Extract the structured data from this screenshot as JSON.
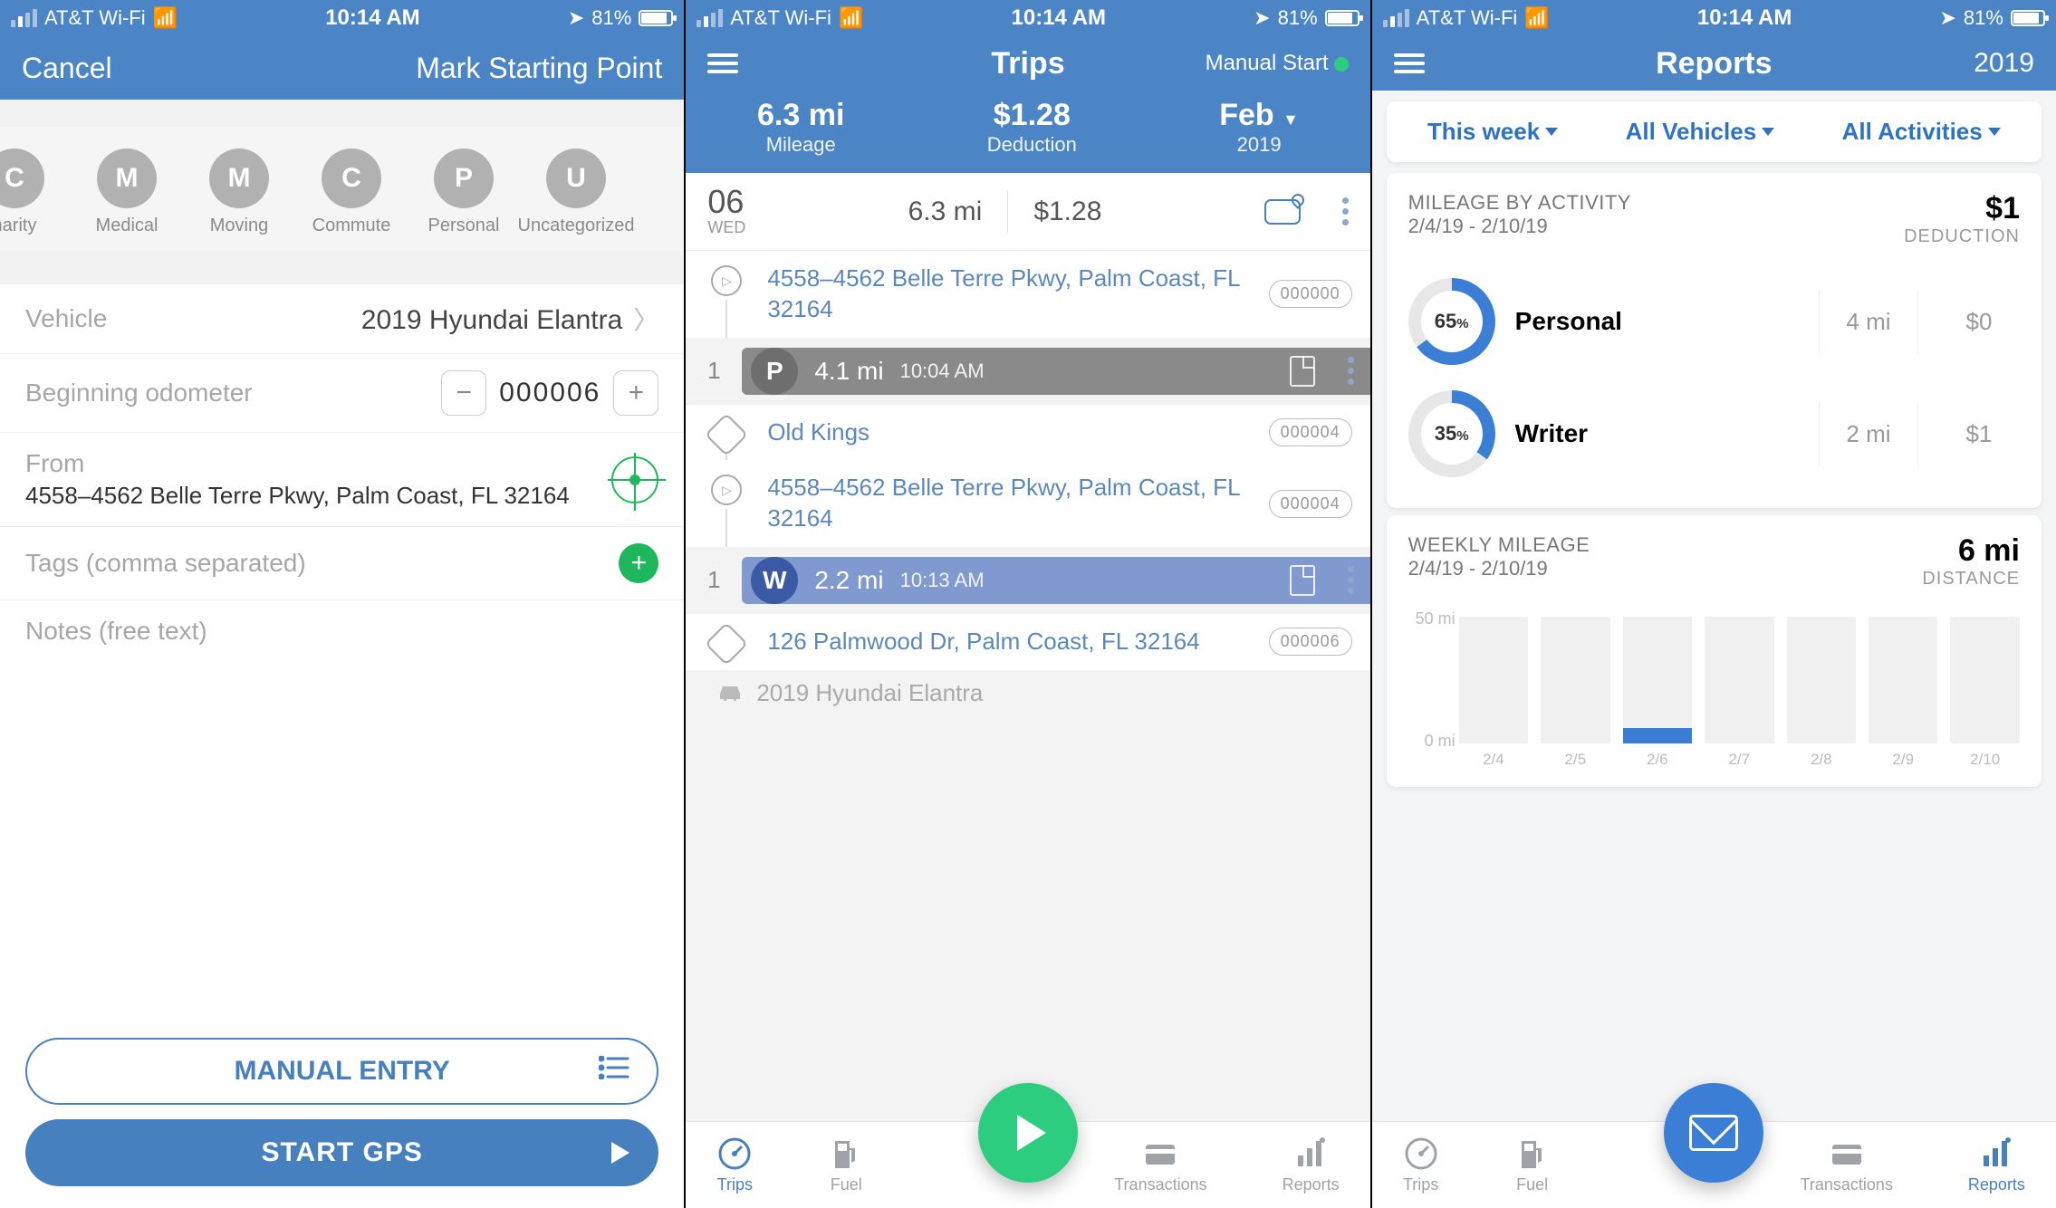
{
  "status": {
    "carrier": "AT&T Wi-Fi",
    "time": "10:14 AM",
    "battery": "81%"
  },
  "screen1": {
    "cancel": "Cancel",
    "title": "Mark Starting Point",
    "categories": [
      {
        "letter": "C",
        "label": "harity"
      },
      {
        "letter": "M",
        "label": "Medical"
      },
      {
        "letter": "M",
        "label": "Moving"
      },
      {
        "letter": "C",
        "label": "Commute"
      },
      {
        "letter": "P",
        "label": "Personal"
      },
      {
        "letter": "U",
        "label": "Uncategorized"
      }
    ],
    "vehicle_label": "Vehicle",
    "vehicle_value": "2019 Hyundai  Elantra",
    "odo_label": "Beginning odometer",
    "odo_value": "000006",
    "from_label": "From",
    "from_addr": "4558–4562 Belle Terre Pkwy, Palm Coast, FL  32164",
    "tags_label": "Tags (comma separated)",
    "notes_label": "Notes (free text)",
    "manual_btn": "MANUAL ENTRY",
    "gps_btn": "START GPS"
  },
  "screen2": {
    "title": "Trips",
    "manual": "Manual Start",
    "stats": {
      "mileage": "6.3 mi",
      "mileage_l": "Mileage",
      "deduction": "$1.28",
      "deduction_l": "Deduction",
      "month": "Feb",
      "year": "2019"
    },
    "day": {
      "num": "06",
      "dow": "WED",
      "mi": "6.3 mi",
      "ded": "$1.28"
    },
    "trips": [
      {
        "start": "4558–4562 Belle Terre Pkwy, Palm Coast, FL  32164",
        "start_odo": "000000",
        "cat": "P",
        "mi": "4.1 mi",
        "time": "10:04 AM",
        "end": "Old Kings",
        "end_odo": "000004"
      },
      {
        "start": "4558–4562 Belle Terre Pkwy, Palm Coast, FL  32164",
        "start_odo": "000004",
        "cat": "W",
        "mi": "2.2 mi",
        "time": "10:13 AM",
        "end": "126 Palmwood Dr, Palm Coast, FL  32164",
        "end_odo": "000006"
      }
    ],
    "vehicle": "2019 Hyundai  Elantra",
    "tabs": {
      "trips": "Trips",
      "fuel": "Fuel",
      "trans": "Transactions",
      "reports": "Reports"
    }
  },
  "screen3": {
    "title": "Reports",
    "year": "2019",
    "filters": {
      "period": "This week",
      "vehicles": "All Vehicles",
      "activities": "All Activities"
    },
    "mba": {
      "title": "MILEAGE BY ACTIVITY",
      "range": "2/4/19 - 2/10/19",
      "ded": "$1",
      "ded_l": "DEDUCTION",
      "rows": [
        {
          "pct": 65,
          "pct_s": "65",
          "name": "Personal",
          "mi": "4 mi",
          "ded": "$0"
        },
        {
          "pct": 35,
          "pct_s": "35",
          "name": "Writer",
          "mi": "2 mi",
          "ded": "$1"
        }
      ]
    },
    "weekly": {
      "title": "WEEKLY MILEAGE",
      "range": "2/4/19 - 2/10/19",
      "total": "6 mi",
      "total_l": "DISTANCE",
      "ymax": "50 mi",
      "ymin": "0 mi",
      "x": [
        "2/4",
        "2/5",
        "2/6",
        "2/7",
        "2/8",
        "2/9",
        "2/10"
      ],
      "bars": [
        0,
        0,
        6,
        0,
        0,
        0,
        0
      ]
    }
  },
  "chart_data": {
    "type": "bar",
    "categories": [
      "2/4",
      "2/5",
      "2/6",
      "2/7",
      "2/8",
      "2/9",
      "2/10"
    ],
    "values": [
      0,
      0,
      6,
      0,
      0,
      0,
      0
    ],
    "title": "Weekly Mileage",
    "xlabel": "",
    "ylabel": "mi",
    "ylim": [
      0,
      50
    ]
  }
}
